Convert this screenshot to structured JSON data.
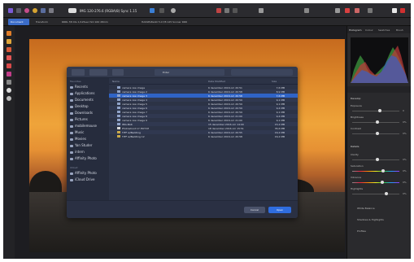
{
  "app": {
    "document_label": "IMG 120-276.6 (RGBA/8) Sync 1.15"
  },
  "context_toolbar": {
    "item1": "Document",
    "item2": "Transform",
    "info": "RRRL  f/8 4tu  1/125sec  ISO 160  28mm",
    "info2": "HASSELBLAD  5.0  f/8  125  Sonnar RRR"
  },
  "right_panel": {
    "tabs": [
      "Histogram",
      "Colour",
      "Swatches",
      "Brush"
    ],
    "section_label": "Develop",
    "section2_label": "Details",
    "sliders": [
      {
        "label": "Exposure",
        "value": "0",
        "pos": 0.55
      },
      {
        "label": "Brightness",
        "value": "0%",
        "pos": 0.5
      },
      {
        "label": "Contrast",
        "value": "0%",
        "pos": 0.5
      },
      {
        "label": "Clarity",
        "value": "0%",
        "pos": 0.5
      },
      {
        "label": "Saturation",
        "value": "0%",
        "pos": 0.62
      },
      {
        "label": "Vibrance",
        "value": "0%",
        "pos": 0.6
      },
      {
        "label": "Highlights",
        "value": "0%",
        "pos": 0.7
      }
    ],
    "panel_items": [
      "White Balance",
      "Shadows & Highlights",
      "Profiles"
    ]
  },
  "dialog": {
    "folder": "Enter",
    "sidebar": {
      "favorites_header": "Favorites",
      "favorites": [
        "Recents",
        "Applications",
        "Documents",
        "Desktop",
        "Downloads",
        "Pictures",
        "mobilemouse",
        "Music",
        "Movies",
        "Yan Studer",
        "intern",
        "Affinity Photo"
      ],
      "icloud_header": "iCloud",
      "icloud": [
        "Affinity Photo",
        "iCloud Drive"
      ]
    },
    "columns": {
      "name": "Name",
      "date": "Date Modified",
      "size": "Size"
    },
    "files": [
      {
        "name": "camera raw image",
        "date": "6 december 2016 om 20:51",
        "size": "7,6 MB",
        "kind": "raw"
      },
      {
        "name": "camera raw image 2",
        "date": "6 december 2016 om 20:58",
        "size": "8,9 MB",
        "kind": "raw"
      },
      {
        "name": "camera raw image 3",
        "date": "6 december 2016 om 20:58",
        "size": "7,6 MB",
        "kind": "raw"
      },
      {
        "name": "camera raw image 4",
        "date": "6 december 2016 om 20:59",
        "size": "9,1 MB",
        "kind": "raw"
      },
      {
        "name": "camera raw image 5",
        "date": "6 december 2016 om 20:59",
        "size": "9,1 MB",
        "kind": "raw"
      },
      {
        "name": "camera raw image 6",
        "date": "6 december 2016 om 20:59",
        "size": "9,4 MB",
        "kind": "raw"
      },
      {
        "name": "camera raw image 7",
        "date": "6 december 2016 om 20:59",
        "size": "9,1 MB",
        "kind": "raw"
      },
      {
        "name": "camera raw image 8",
        "date": "6 december 2016 om 21:00",
        "size": "9,4 MB",
        "kind": "raw"
      },
      {
        "name": "camera raw image 9",
        "date": "6 december 2016 om 21:00",
        "size": "9,1 MB",
        "kind": "raw"
      },
      {
        "name": "IMG.BAK",
        "date": "15 december 2016 om 14:00",
        "size": "15,2 MB",
        "kind": "raw"
      },
      {
        "name": "Photoshoot 17-HOT.tif",
        "date": "18 december 2016 om 15:51",
        "size": "35,6 MB",
        "kind": "pdf"
      },
      {
        "name": "TIFF w/Bedding",
        "date": "6 december 2016 om 20:55",
        "size": "16,2 MB",
        "kind": "tif"
      },
      {
        "name": "TIFF w/Bedding 12",
        "date": "6 december 2016 om 20:58",
        "size": "16,2 MB",
        "kind": "tif"
      }
    ],
    "selected_index": 2,
    "cancel_label": "Cancel",
    "open_label": "Open"
  }
}
